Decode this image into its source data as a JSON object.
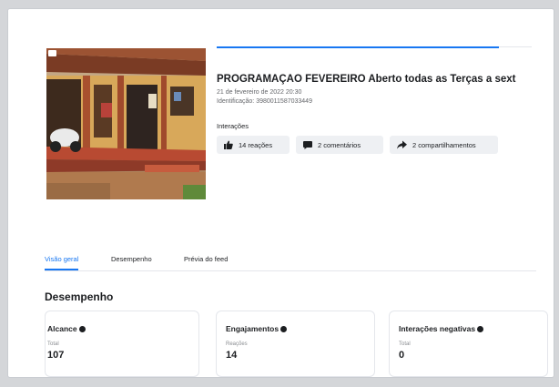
{
  "post": {
    "title": "PROGRAMAÇÃO FEVEREIRO Aberto todas as Terças a sext",
    "date": "21 de fevereiro de 2022 20:30",
    "id": "Identificação: 3980011587033449",
    "interactions_label": "Interações"
  },
  "chips": {
    "reactions": "14 reações",
    "comments": "2 comentários",
    "shares": "2 compartilhamentos"
  },
  "tabs": [
    {
      "label": "Visão geral",
      "active": true
    },
    {
      "label": "Desempenho",
      "active": false
    },
    {
      "label": "Prévia do feed",
      "active": false
    }
  ],
  "section_title": "Desempenho",
  "metrics": [
    {
      "label": "Alcance",
      "sub": "Total",
      "value": "107"
    },
    {
      "label": "Engajamentos",
      "sub": "Reações",
      "value": "14"
    },
    {
      "label": "Interações negativas",
      "sub": "Total",
      "value": "0"
    }
  ],
  "icons": {
    "reactions": "thumbs-up-icon",
    "comments": "comment-icon",
    "shares": "share-icon",
    "info": "info-icon"
  },
  "colors": {
    "accent": "#1877f2",
    "chip_bg": "#eef0f3"
  }
}
